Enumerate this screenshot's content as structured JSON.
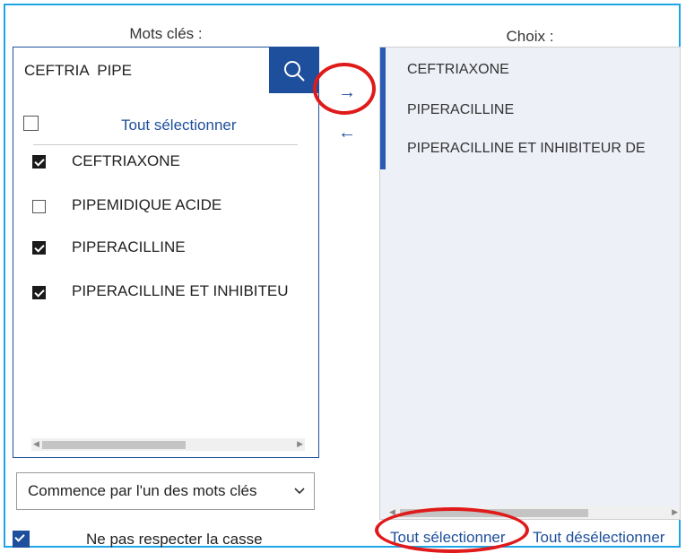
{
  "left_panel": {
    "heading": "Mots clés :",
    "search": {
      "value": "CEFTRIA  PIPE",
      "placeholder": ""
    },
    "select_all_label": "Tout sélectionner",
    "items": [
      {
        "label": "CEFTRIAXONE",
        "checked": true
      },
      {
        "label": "PIPEMIDIQUE ACIDE",
        "checked": false
      },
      {
        "label": "PIPERACILLINE",
        "checked": true
      },
      {
        "label": "PIPERACILLINE ET INHIBITEU",
        "checked": true
      }
    ],
    "match_mode": "Commence par l'un des mots clés",
    "case_insensitive_label": "Ne pas respecter la casse",
    "case_insensitive_checked": true
  },
  "transfer": {
    "add_icon": "arrow-right-icon",
    "remove_icon": "arrow-left-icon"
  },
  "right_panel": {
    "heading": "Choix :",
    "items": [
      {
        "label": "CEFTRIAXONE"
      },
      {
        "label": "PIPERACILLINE"
      },
      {
        "label": "PIPERACILLINE ET INHIBITEUR DE"
      }
    ],
    "select_all_link": "Tout sélectionner",
    "deselect_all_link": "Tout désélectionner"
  },
  "colors": {
    "accent": "#1e4f9c",
    "frame": "#1ea5e8",
    "highlight": "#e01a1a",
    "choice_bg": "#eef0f8"
  }
}
